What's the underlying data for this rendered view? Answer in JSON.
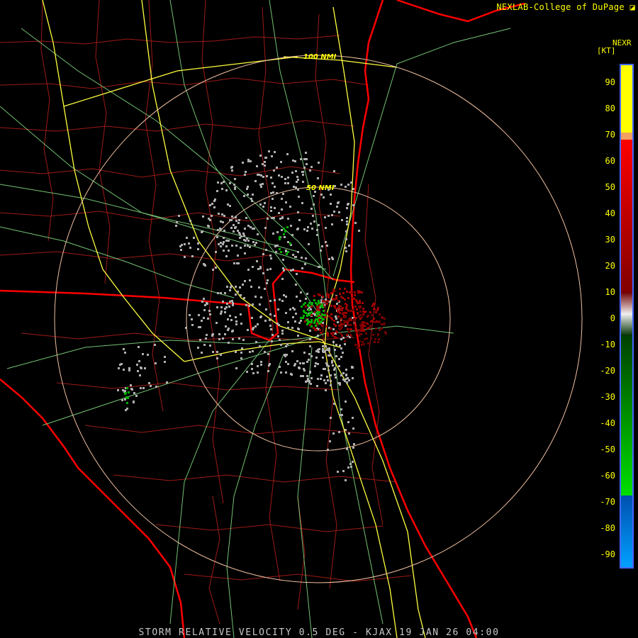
{
  "credit": "NEXLAB-College of DuPage",
  "legend": {
    "title": "NEXR",
    "unit": "[KT]",
    "ticks": [
      "90",
      "80",
      "70",
      "60",
      "50",
      "40",
      "30",
      "20",
      "10",
      "0",
      "-10",
      "-20",
      "-30",
      "-40",
      "-50",
      "-60",
      "-70",
      "-80",
      "-90"
    ]
  },
  "range_rings": [
    "100 NMI",
    "50 NMI"
  ],
  "footer": "STORM RELATIVE VELOCITY 0.5 DEG - KJAX 19 JAN 26 04:00",
  "colors": {
    "state_border": "#ff0000",
    "county_border": "#c0201c",
    "highway": "#ffff40",
    "road": "#80d880",
    "ring": "#f0c0a0",
    "inbound": "#00b000",
    "outbound": "#a00000",
    "neutral": "#b0b0b0"
  }
}
